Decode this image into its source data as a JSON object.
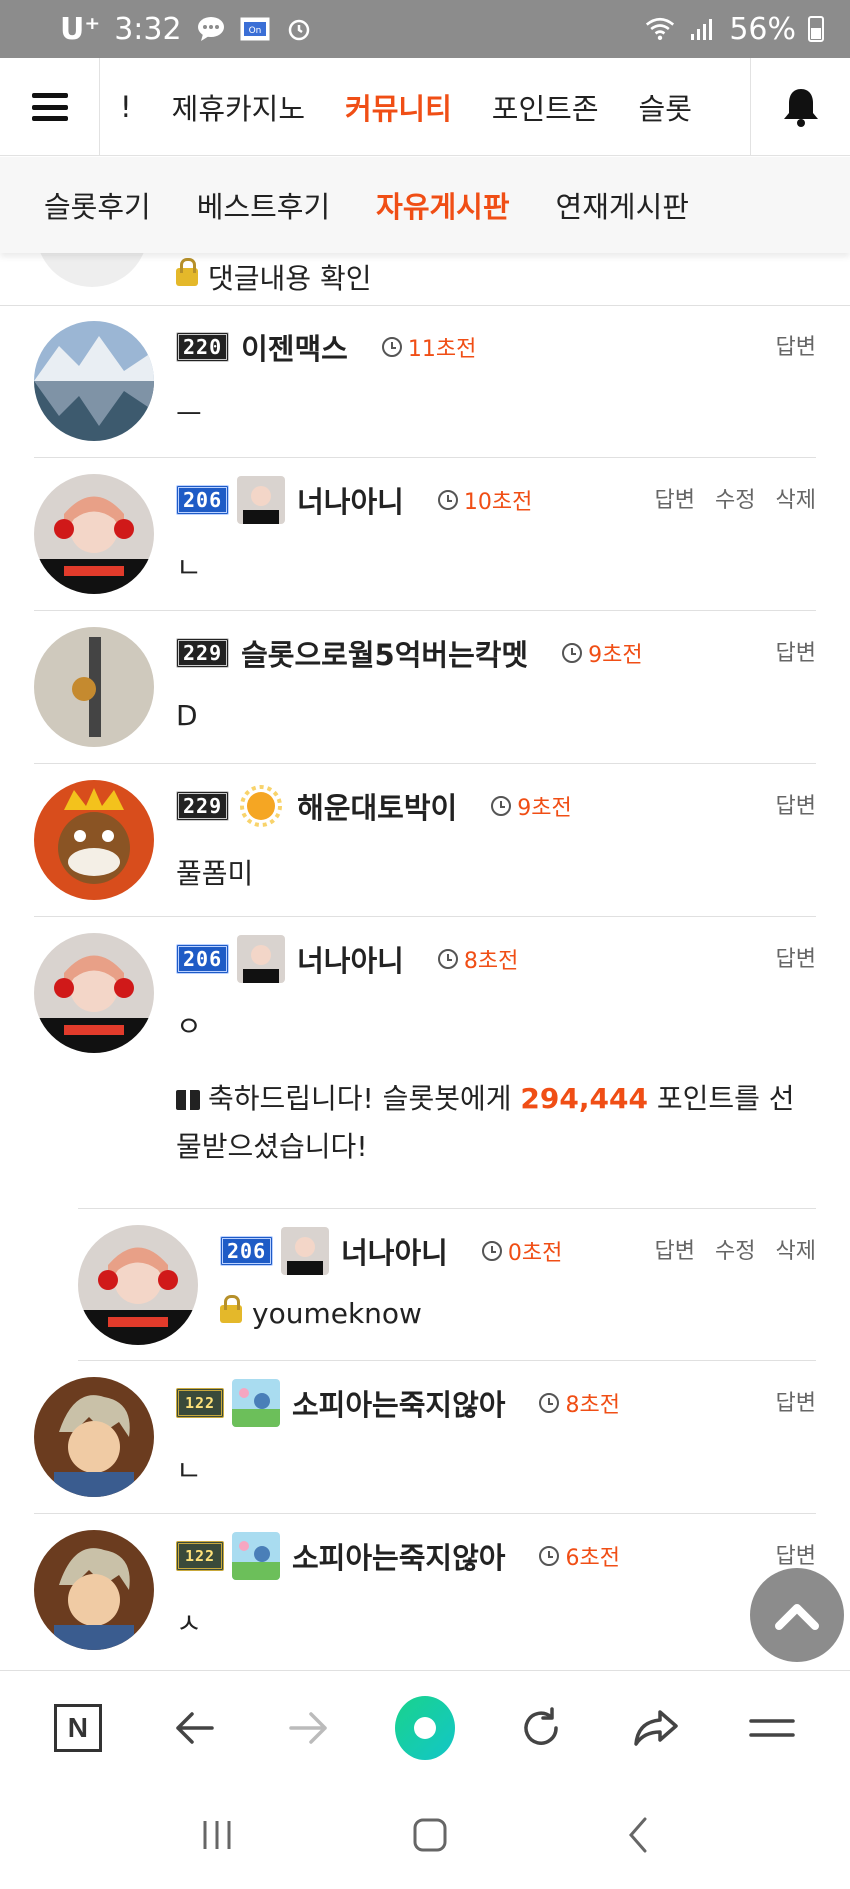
{
  "status_bar": {
    "carrier": "U⁺",
    "time": "3:32",
    "battery": "56%"
  },
  "top_nav": {
    "items": [
      "!",
      "제휴카지노",
      "커뮤니티",
      "포인트존",
      "슬롯"
    ],
    "active_index": 2
  },
  "sub_nav": {
    "items": [
      "슬롯후기",
      "베스트후기",
      "자유게시판",
      "연재게시판"
    ],
    "active_index": 2
  },
  "partial_comment": {
    "text": "댓글내용 확인"
  },
  "comments": [
    {
      "level": "220",
      "nick": "이젠맥스",
      "time": "11초전",
      "actions": [
        "답변"
      ],
      "body": "ㅡ"
    },
    {
      "level": "206",
      "nick": "너나아니",
      "time": "10초전",
      "actions": [
        "답변",
        "수정",
        "삭제"
      ],
      "body": "ㄴ"
    },
    {
      "level": "229",
      "nick": "슬롯으로월5억버는칵멧",
      "time": "9초전",
      "actions": [
        "답변"
      ],
      "body": "D"
    },
    {
      "level": "229",
      "nick": "해운대토박이",
      "time": "9초전",
      "actions": [
        "답변"
      ],
      "body": "풀폼미"
    },
    {
      "level": "206",
      "nick": "너나아니",
      "time": "8초전",
      "actions": [
        "답변"
      ],
      "body": "ㅇ",
      "notice": {
        "prefix": "축하드립니다! 슬롯봇에게 ",
        "points": "294,444",
        "suffix": " 포인트를 선물받으셨습니다!"
      }
    },
    {
      "level": "206",
      "nick": "너나아니",
      "time": "0초전",
      "actions": [
        "답변",
        "수정",
        "삭제"
      ],
      "body": "youmeknow"
    },
    {
      "level": "122",
      "nick": "소피아는죽지않아",
      "time": "8초전",
      "actions": [
        "답변"
      ],
      "body": "ㄴ"
    },
    {
      "level": "122",
      "nick": "소피아는죽지않아",
      "time": "6초전",
      "actions": [
        "답변"
      ],
      "body": "ㅅ"
    }
  ],
  "colors": {
    "accent": "#f04e15",
    "level_blue": "#1e5bc6",
    "status_bar": "#8c8c8c"
  }
}
